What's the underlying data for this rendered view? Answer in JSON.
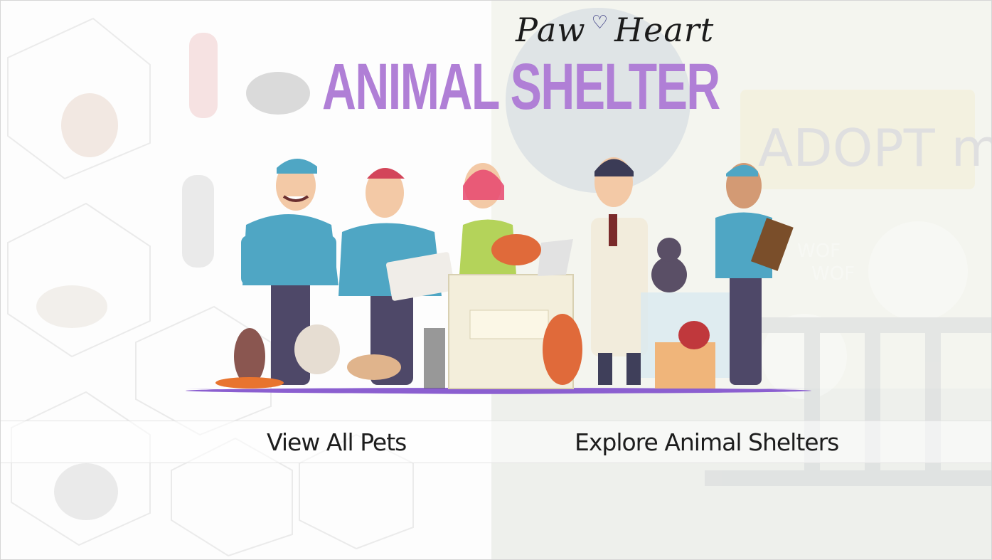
{
  "brand": {
    "script_left": "Paw",
    "heart_glyph": "♡",
    "script_right": "Heart",
    "title": "ANIMAL SHELTER"
  },
  "background": {
    "sign_text": "ADOPT me!",
    "bark_line1": "WOF",
    "bark_line2": "WOF"
  },
  "nav": {
    "view_pets": "View All Pets",
    "explore_shelters": "Explore Animal Shelters"
  },
  "colors": {
    "title_purple": "#b07fd6",
    "ground_purple": "#8b5fd0",
    "staff_teal": "#4fa6c4",
    "right_panel": "#f4f5ef"
  },
  "icons": {
    "heart": "heart-icon"
  }
}
